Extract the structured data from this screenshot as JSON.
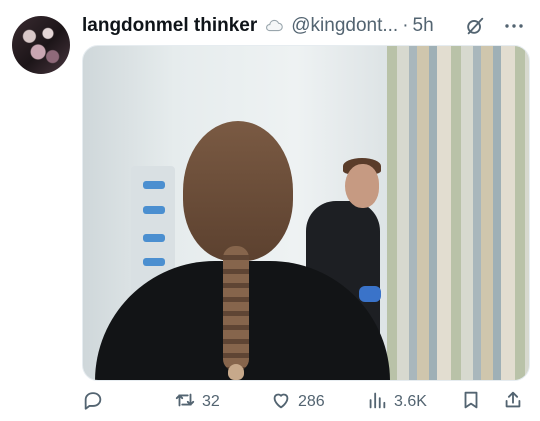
{
  "author": {
    "display_name": "langdonmel thinker",
    "handle": "@kingdont...",
    "separator": "·",
    "time": "5h",
    "verified_icon": "cloud-badge-icon"
  },
  "actions": {
    "reply": {
      "icon": "reply-icon",
      "count": ""
    },
    "repost": {
      "icon": "repost-icon",
      "count": "32"
    },
    "like": {
      "icon": "heart-icon",
      "count": "286"
    },
    "views": {
      "icon": "views-icon",
      "count": "3.6K"
    },
    "bookmark": {
      "icon": "bookmark-icon"
    },
    "share": {
      "icon": "share-icon"
    }
  },
  "colors": {
    "text_primary": "#0f1419",
    "text_secondary": "#536471",
    "border": "#e6ecf0"
  }
}
